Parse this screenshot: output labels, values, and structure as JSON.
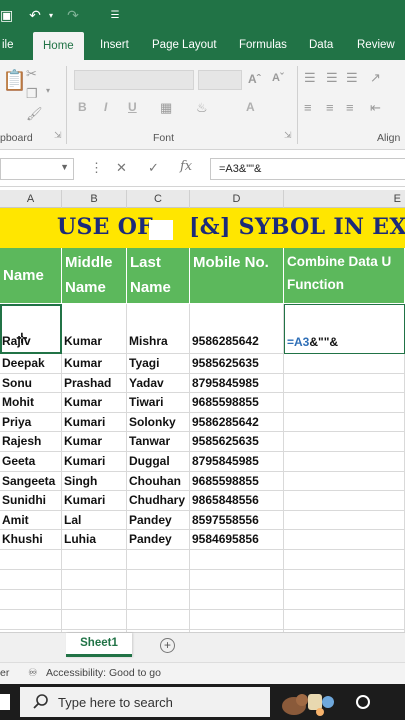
{
  "ribbon": {
    "tabs": [
      "ile",
      "Home",
      "Insert",
      "Page Layout",
      "Formulas",
      "Data",
      "Review"
    ],
    "active_tab": "Home",
    "groups": {
      "clipboard": "pboard",
      "font": "Font",
      "alignment": "Align"
    },
    "font_buttons": [
      "B",
      "I",
      "U",
      "A",
      "A"
    ]
  },
  "formula_bar": {
    "name_box": "",
    "cancel": "✕",
    "enter": "✓",
    "fx": "fx",
    "content": "=A3&\"\"&"
  },
  "columns": [
    "A",
    "B",
    "C",
    "D",
    "E"
  ],
  "sheet": {
    "banner_left": "USE OF",
    "banner_right": "[&] SYBOL IN EXC",
    "headers": [
      "Name",
      "Middle Name",
      "Last Name",
      "Mobile No.",
      "Combine Data U Function"
    ],
    "rows": [
      [
        "Rajiv",
        "Kumar",
        "Mishra",
        "9586285642"
      ],
      [
        "Deepak",
        "Kumar",
        "Tyagi",
        "9585625635"
      ],
      [
        "Sonu",
        "Prashad",
        "Yadav",
        "8795845985"
      ],
      [
        "Mohit",
        "Kumar",
        "Tiwari",
        "9685598855"
      ],
      [
        "Priya",
        "Kumari",
        "Solonky",
        "9586285642"
      ],
      [
        "Rajesh",
        "Kumar",
        "Tanwar",
        "9585625635"
      ],
      [
        "Geeta",
        "Kumari",
        "Duggal",
        "8795845985"
      ],
      [
        "Sangeeta",
        "Singh",
        "Chouhan",
        "9685598855"
      ],
      [
        "Sunidhi",
        "Kumari",
        "Chudhary",
        "9865848556"
      ],
      [
        "Amit",
        "Lal",
        "Pandey",
        "8597558556"
      ],
      [
        "Khushi",
        "Luhia",
        "Pandey",
        "9584695856"
      ]
    ],
    "edit_cell": {
      "ref": "=A3",
      "rest": "&\"\"&"
    }
  },
  "sheet_tabs": {
    "active": "Sheet1",
    "add": "+"
  },
  "status": {
    "left": "er",
    "accessibility": "Accessibility: Good to go"
  },
  "taskbar": {
    "search_placeholder": "Type here to search"
  },
  "colors": {
    "excel_green": "#217346",
    "header_green": "#5cb85c",
    "banner_yellow": "#ffe600",
    "banner_text": "#1b2a7a"
  }
}
